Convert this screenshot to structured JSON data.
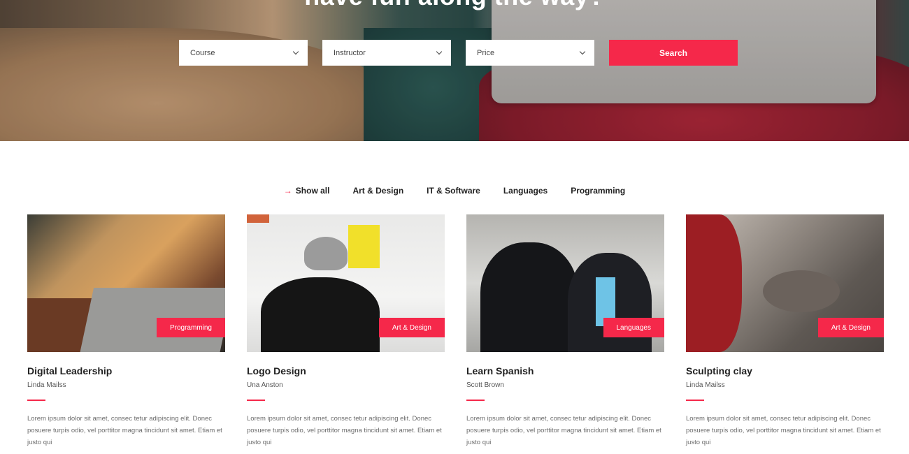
{
  "hero": {
    "title": "have fun along the way?",
    "filters": [
      {
        "label": "Course"
      },
      {
        "label": "Instructor"
      },
      {
        "label": "Price"
      }
    ],
    "search_label": "Search"
  },
  "tabs": {
    "active_arrow": "→",
    "items": [
      "Show all",
      "Art & Design",
      "IT & Software",
      "Languages",
      "Programming"
    ]
  },
  "courses": [
    {
      "category": "Programming",
      "title": "Digital Leadership",
      "author": "Linda Mailss",
      "description": "Lorem ipsum dolor sit amet, consec tetur adipiscing elit. Donec posuere turpis odio, vel porttitor magna tincidunt sit amet. Etiam et justo qui"
    },
    {
      "category": "Art & Design",
      "title": "Logo Design",
      "author": "Una Anston",
      "description": "Lorem ipsum dolor sit amet, consec tetur adipiscing elit. Donec posuere turpis odio, vel porttitor magna tincidunt sit amet. Etiam et justo qui"
    },
    {
      "category": "Languages",
      "title": "Learn Spanish",
      "author": "Scott Brown",
      "description": "Lorem ipsum dolor sit amet, consec tetur adipiscing elit. Donec posuere turpis odio, vel porttitor magna tincidunt sit amet. Etiam et justo qui"
    },
    {
      "category": "Art & Design",
      "title": "Sculpting clay",
      "author": "Linda Mailss",
      "description": "Lorem ipsum dolor sit amet, consec tetur adipiscing elit. Donec posuere turpis odio, vel porttitor magna tincidunt sit amet. Etiam et justo qui"
    }
  ],
  "colors": {
    "accent": "#f5284a",
    "heading": "#222222",
    "body_text": "#6b6b6b"
  },
  "icons": {
    "dropdown": "chevron-down-icon",
    "active_tab": "arrow-right-icon"
  }
}
